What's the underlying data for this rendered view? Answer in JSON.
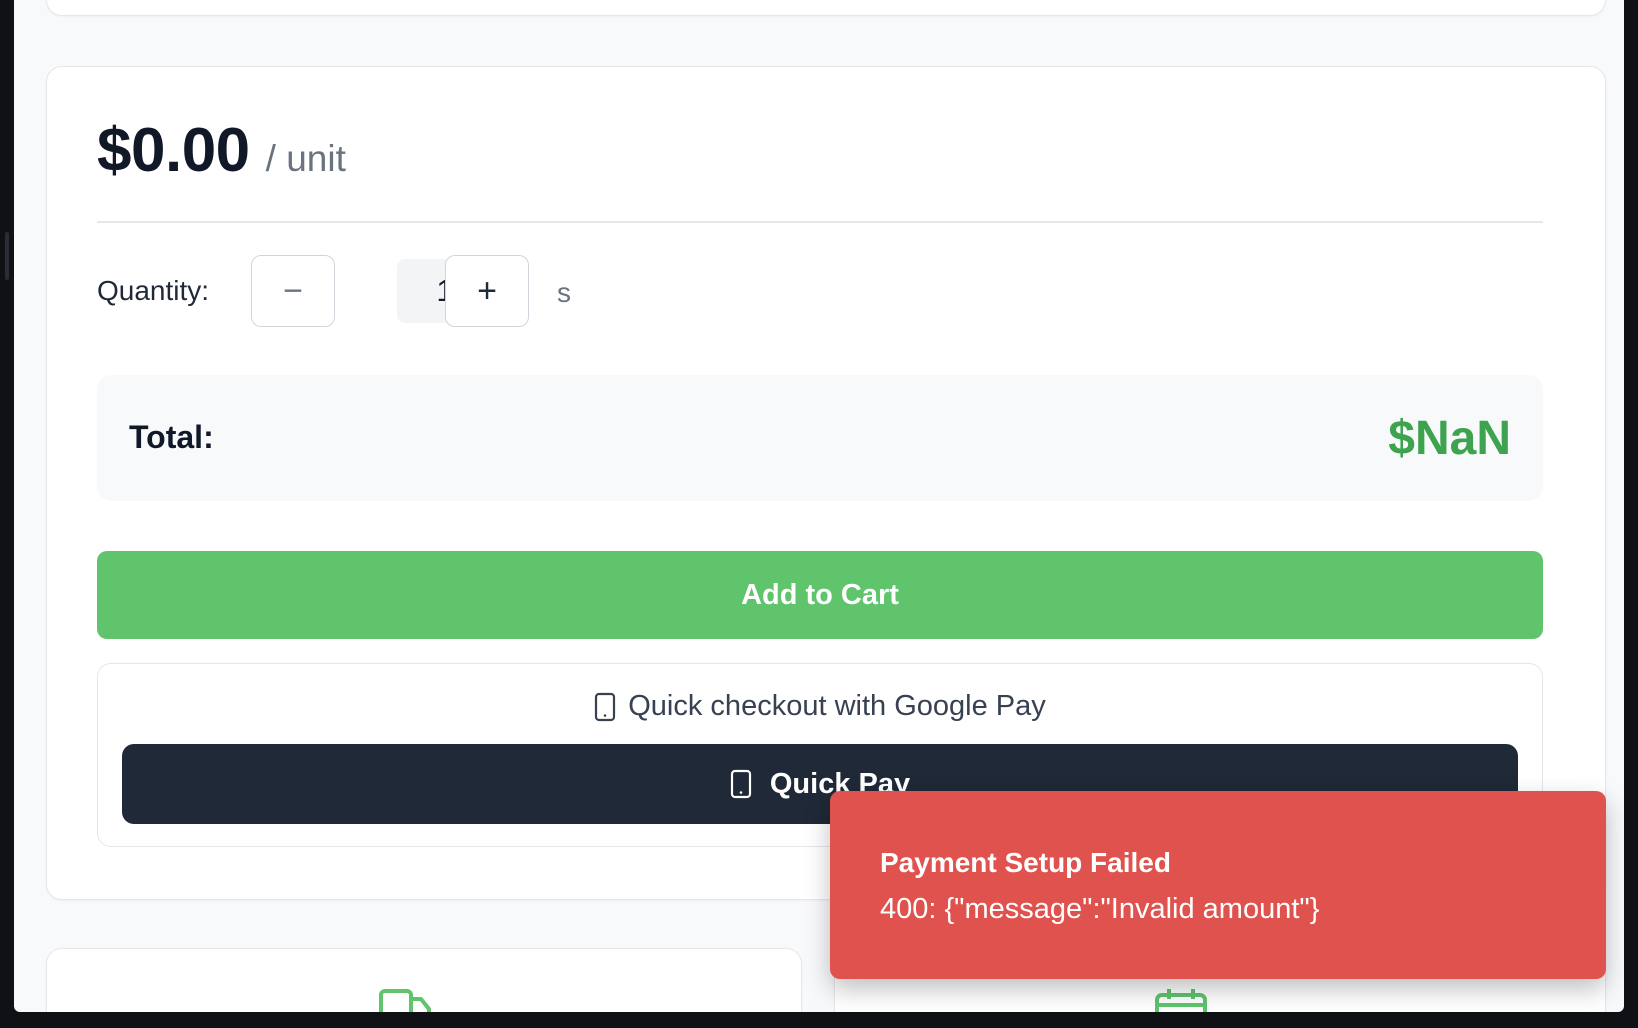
{
  "product": {
    "price": "$0.00",
    "unit_label": "/ unit"
  },
  "quantity": {
    "label": "Quantity:",
    "decrement_symbol": "−",
    "value": "1",
    "increment_symbol": "+",
    "suffix": "s"
  },
  "total": {
    "label": "Total:",
    "value": "$NaN"
  },
  "actions": {
    "add_to_cart_label": "Add to Cart",
    "quick_checkout_caption": "Quick checkout with Google Pay",
    "quick_pay_label": "Quick Pay"
  },
  "toast": {
    "title": "Payment Setup Failed",
    "message": "400: {\"message\":\"Invalid amount\"}"
  },
  "colors": {
    "accent_green": "#5fc46c",
    "total_green": "#3ea34e",
    "dark_button": "#1f2937",
    "error_red": "#e0524d"
  },
  "icons": {
    "checkout_caption_icon": "smartphone-icon",
    "quick_pay_icon": "smartphone-icon",
    "feature_left_icon": "truck-icon",
    "feature_right_icon": "calendar-icon"
  }
}
